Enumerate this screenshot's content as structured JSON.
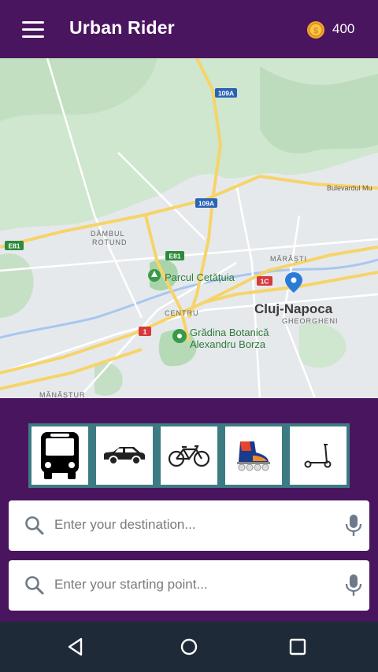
{
  "app": {
    "title": "Urban Rider",
    "coins": "400"
  },
  "map": {
    "labels": {
      "road_109a_top": "109A",
      "road_109a_mid": "109A",
      "road_e81_left": "E81",
      "road_e81_mid": "E81",
      "road_1c": "1C",
      "road_1": "1",
      "bulevard": "Bulevardul Mu",
      "dambul": "DÂMBUL",
      "rotund": "ROTUND",
      "marasti": "MĂRĂȘTI",
      "parcul": "Parcul Cetățuia",
      "cluj": "Cluj-Napoca",
      "gheorgheni": "GHEORGHENI",
      "centru": "CENTRU",
      "gradina_line1": "Grădina Botanică",
      "gradina_line2": "Alexandru Borza",
      "manastur": "MĂNĂȘTUR"
    }
  },
  "transport_modes": [
    {
      "name": "bus",
      "icon": "bus-icon"
    },
    {
      "name": "car",
      "icon": "car-icon"
    },
    {
      "name": "bicycle",
      "icon": "bicycle-icon"
    },
    {
      "name": "roller-skate",
      "icon": "roller-skate-icon"
    },
    {
      "name": "scooter",
      "icon": "scooter-icon"
    }
  ],
  "search": {
    "destination_placeholder": "Enter your destination...",
    "start_placeholder": "Enter your starting point..."
  },
  "colors": {
    "primary": "#4a155f",
    "mode_border": "#3d7b83",
    "navbar": "#1f2a38"
  }
}
